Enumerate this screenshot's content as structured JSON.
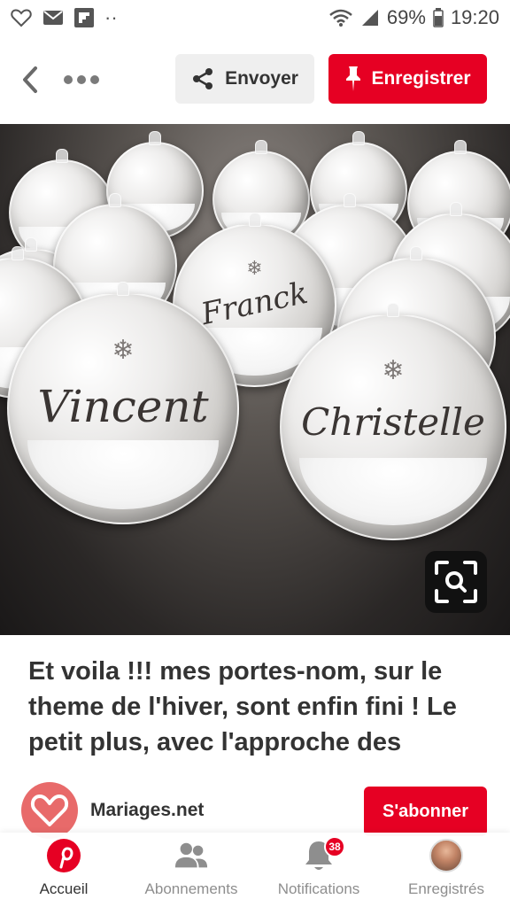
{
  "status_bar": {
    "battery": "69%",
    "time": "19:20",
    "dots": "··"
  },
  "toolbar": {
    "share_label": "Envoyer",
    "save_label": "Enregistrer"
  },
  "image": {
    "names": [
      "Vincent",
      "Christelle",
      "Franck"
    ]
  },
  "pin": {
    "description": "Et voila !!! mes portes-nom, sur le theme de l'hiver, sont enfin fini ! Le petit plus, avec l'approche des"
  },
  "author": {
    "name": "Mariages.net",
    "follow_label": "S'abonner"
  },
  "bottom_nav": {
    "items": [
      {
        "label": "Accueil",
        "icon": "pinterest-logo-icon",
        "active": true
      },
      {
        "label": "Abonnements",
        "icon": "people-icon",
        "active": false
      },
      {
        "label": "Notifications",
        "icon": "bell-icon",
        "active": false,
        "badge": "38"
      },
      {
        "label": "Enregistrés",
        "icon": "profile-avatar",
        "active": false
      }
    ]
  },
  "colors": {
    "accent": "#e60023",
    "text": "#333333",
    "muted": "#8e8e8e"
  }
}
